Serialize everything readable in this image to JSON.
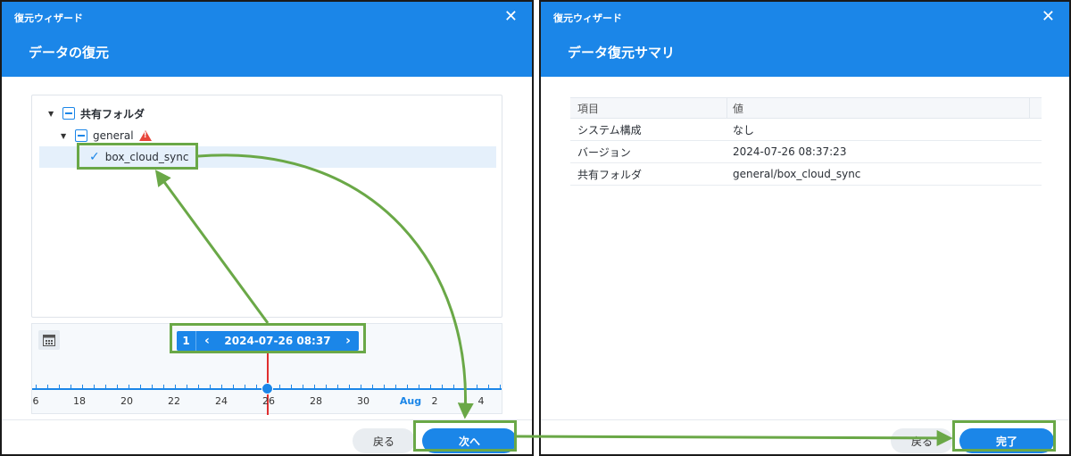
{
  "left": {
    "app_title": "復元ウィザード",
    "step_title": "データの復元",
    "tree": {
      "root": "共有フォルダ",
      "child": "general",
      "leaf": "box_cloud_sync"
    },
    "timeline": {
      "count": "1",
      "date": "2024-07-26 08:37",
      "ticks": [
        "6",
        "18",
        "20",
        "22",
        "24",
        "26",
        "28",
        "30",
        "Aug",
        "2",
        "4"
      ]
    },
    "buttons": {
      "back": "戻る",
      "next": "次へ"
    }
  },
  "right": {
    "app_title": "復元ウィザード",
    "step_title": "データ復元サマリ",
    "table": {
      "headers": [
        "項目",
        "値"
      ],
      "rows": [
        [
          "システム構成",
          "なし"
        ],
        [
          "バージョン",
          "2024-07-26 08:37:23"
        ],
        [
          "共有フォルダ",
          "general/box_cloud_sync"
        ]
      ]
    },
    "buttons": {
      "back": "戻る",
      "finish": "完了"
    }
  },
  "colors": {
    "accent": "#1b86e8",
    "annotation": "#6aa847",
    "warning": "#e8443a",
    "marker": "#e02f2f"
  },
  "icons": [
    "close-icon",
    "caret-down-icon",
    "partial-checkbox-icon",
    "check-icon",
    "warning-icon",
    "calendar-icon",
    "chevron-left-icon",
    "chevron-right-icon"
  ]
}
